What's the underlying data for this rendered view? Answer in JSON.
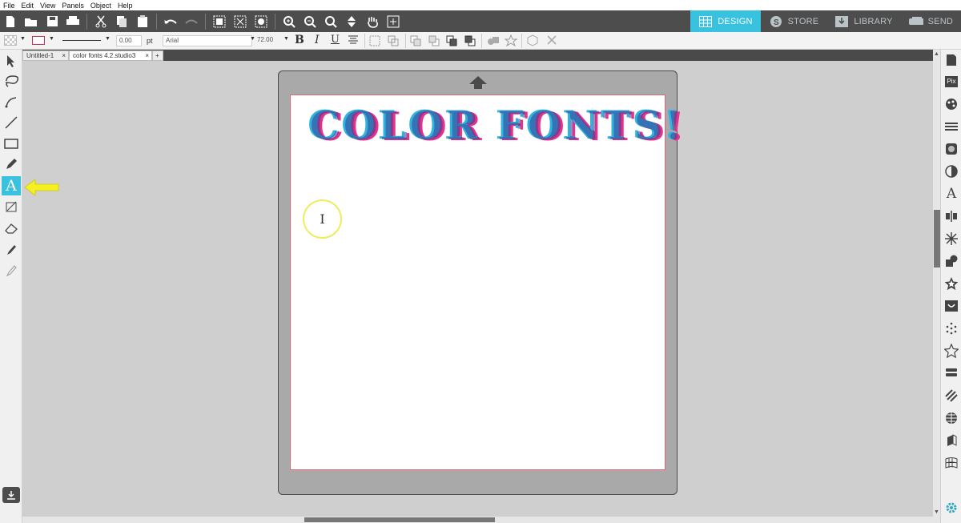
{
  "menu": [
    "File",
    "Edit",
    "View",
    "Panels",
    "Object",
    "Help"
  ],
  "nav": [
    {
      "label": "DESIGN",
      "icon": "grid-icon",
      "active": true
    },
    {
      "label": "STORE",
      "icon": "store-s-icon",
      "active": false
    },
    {
      "label": "LIBRARY",
      "icon": "download-box-icon",
      "active": false
    },
    {
      "label": "SEND",
      "icon": "send-machine-icon",
      "active": false
    }
  ],
  "toolbar2": {
    "line_width": "0.00",
    "line_unit": "pt",
    "font_name": "Arial",
    "font_size": "72.00",
    "bold": "B",
    "italic": "I",
    "underline": "U"
  },
  "tabs": [
    {
      "label": "Untitled-1",
      "close": "×"
    },
    {
      "label": "color fonts 4.2.studio3",
      "close": "×"
    },
    {
      "label": "+",
      "close": ""
    }
  ],
  "canvas": {
    "title_text": "COLOR FONTS!",
    "cursor_glyph": "I",
    "colors": {
      "pink": "#e5338c",
      "blue": "#2fb3e2",
      "navy": "#3a3f8f",
      "accent": "#38c2e0"
    }
  },
  "right_panel_text": {
    "pix": "Pix",
    "text_icon": "A"
  },
  "left_tools": [
    "select-arrow-icon",
    "lasso-icon",
    "bezier-icon",
    "line-icon",
    "rectangle-icon",
    "pencil-icon",
    "text-icon",
    "knife-icon",
    "eraser-icon",
    "eyedropper-icon",
    "fill-eyedropper-icon"
  ]
}
